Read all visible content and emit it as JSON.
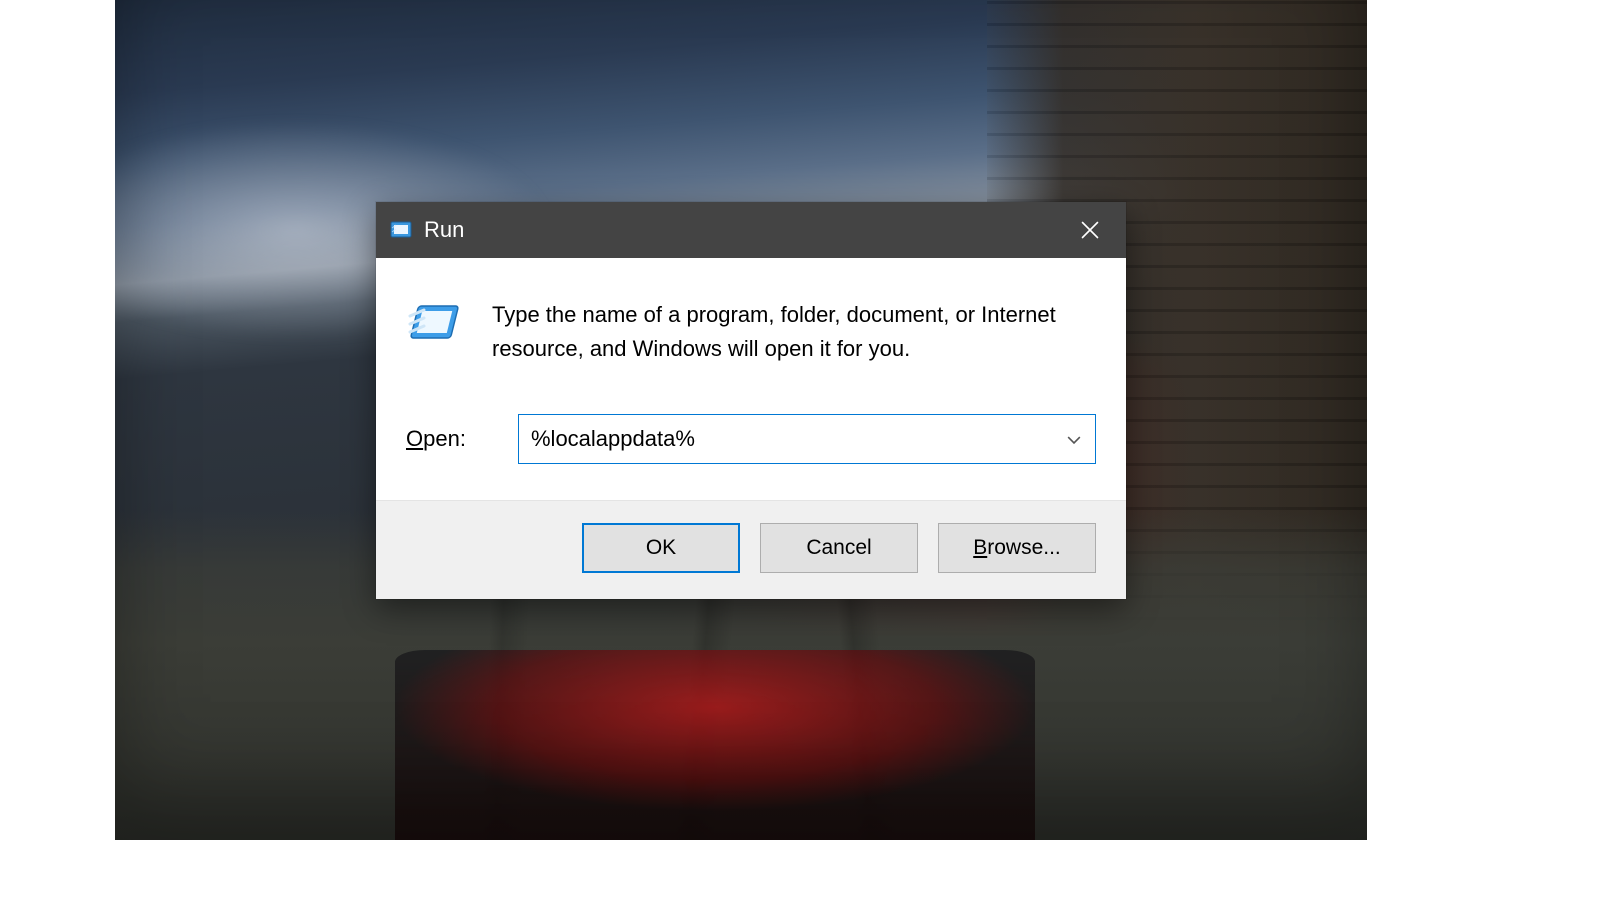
{
  "dialog": {
    "title": "Run",
    "description": "Type the name of a program, folder, document, or Internet resource, and Windows will open it for you.",
    "open_label": "Open:",
    "open_value": "%localappdata%",
    "buttons": {
      "ok": "OK",
      "cancel": "Cancel",
      "browse": "Browse..."
    },
    "accelerators": {
      "open_underline_char": "O",
      "browse_underline_char": "B"
    },
    "icons": {
      "titlebar": "run-app-icon",
      "close": "close-icon",
      "body": "run-large-icon",
      "dropdown": "chevron-down-icon"
    }
  }
}
